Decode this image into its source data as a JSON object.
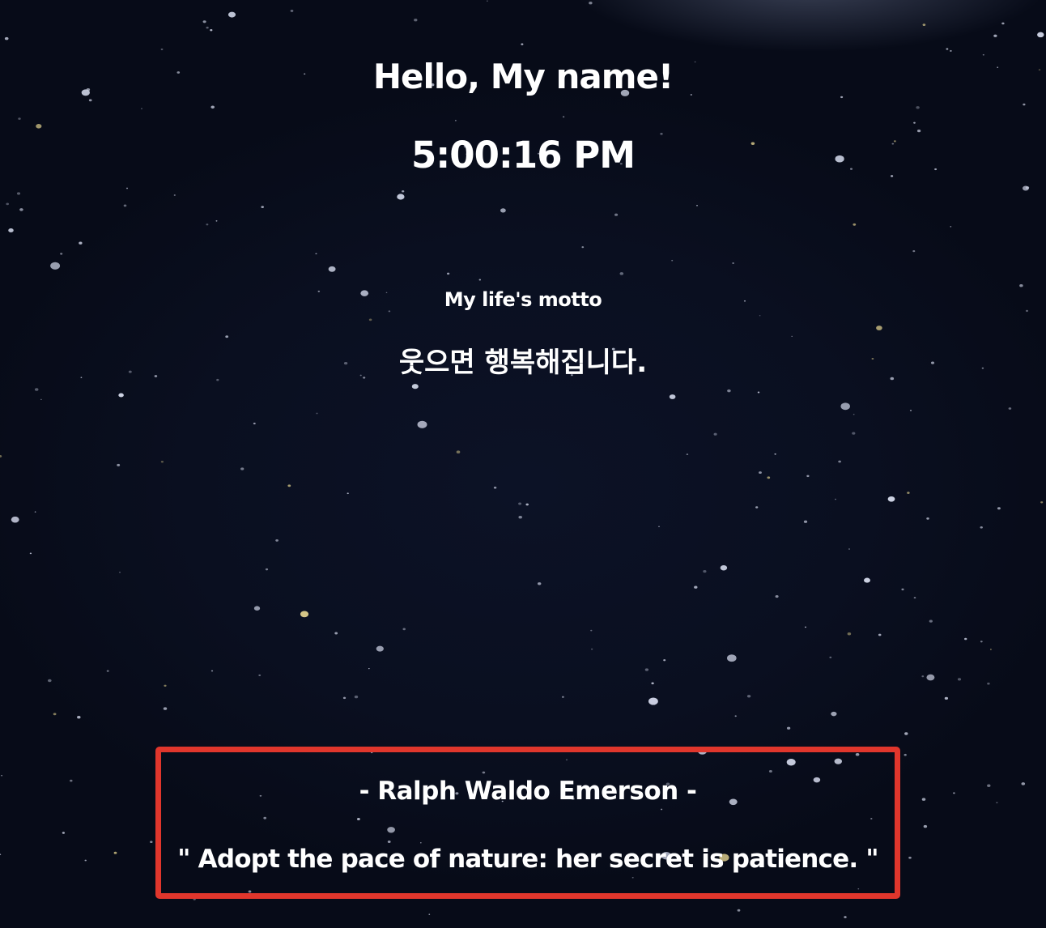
{
  "greeting": {
    "text": "Hello, My name!"
  },
  "clock": {
    "time": "5:00:16 PM"
  },
  "motto": {
    "title": "My life's motto",
    "text": "웃으면 행복해집니다."
  },
  "quote": {
    "author": "- Ralph Waldo Emerson -",
    "text": "\" Adopt the pace of nature: her secret is patience. \""
  },
  "colors": {
    "background": "#0a0f20",
    "text": "#ffffff",
    "highlight_border": "#e0362c"
  }
}
